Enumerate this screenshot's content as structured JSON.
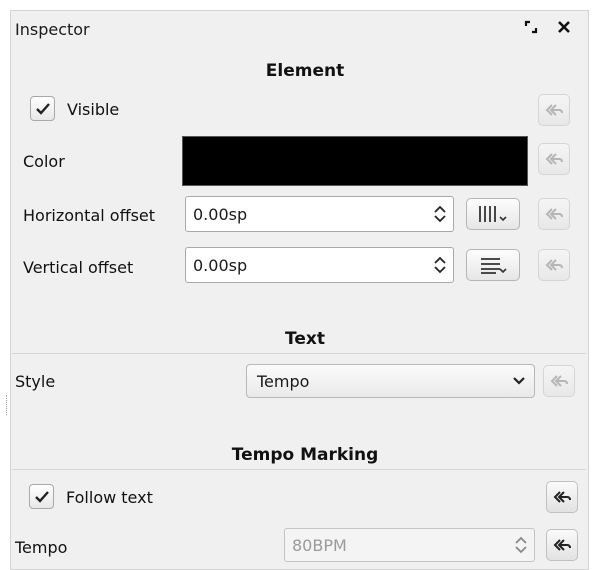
{
  "panel": {
    "title": "Inspector",
    "float_icon": "float-icon",
    "close_icon": "close-icon"
  },
  "element": {
    "heading": "Element",
    "visible": {
      "label": "Visible",
      "checked": true
    },
    "color": {
      "label": "Color",
      "value": "#000000"
    },
    "h_offset": {
      "label": "Horizontal offset",
      "value": "0.00sp"
    },
    "v_offset": {
      "label": "Vertical offset",
      "value": "0.00sp"
    }
  },
  "text": {
    "heading": "Text",
    "style": {
      "label": "Style",
      "value": "Tempo"
    }
  },
  "tempo_marking": {
    "heading": "Tempo Marking",
    "follow_text": {
      "label": "Follow text",
      "checked": true
    },
    "tempo": {
      "label": "Tempo",
      "value": "80BPM",
      "disabled": true
    }
  },
  "icons": {
    "reset": "reset-undo-icon",
    "check": "check-icon",
    "spin_arrows": "spin-arrows-icon",
    "h_align": "horizontal-align-icon",
    "v_align": "vertical-align-icon",
    "dropdown": "chevron-down-icon"
  }
}
